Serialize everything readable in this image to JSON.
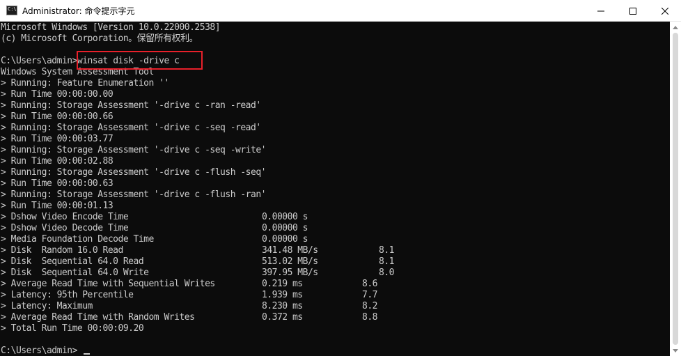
{
  "window": {
    "title": "Administrator: 命令提示字元",
    "icon_name": "cmd-icon",
    "icon_text": "C:\\",
    "controls": [
      "minimize-icon",
      "maximize-icon",
      "close-icon"
    ]
  },
  "console": {
    "header": [
      "Microsoft Windows [Version 10.0.22000.2538]",
      "(c) Microsoft Corporation。保留所有权利。"
    ],
    "prompt": "C:\\Users\\admin>",
    "command": "winsat disk -drive c",
    "tool_name": "Windows System Assessment Tool",
    "run_log": [
      "> Running: Feature Enumeration ''",
      "> Run Time 00:00:00.00",
      "> Running: Storage Assessment '-drive c -ran -read'",
      "> Run Time 00:00:00.66",
      "> Running: Storage Assessment '-drive c -seq -read'",
      "> Run Time 00:00:03.77",
      "> Running: Storage Assessment '-drive c -seq -write'",
      "> Run Time 00:00:02.88",
      "> Running: Storage Assessment '-drive c -flush -seq'",
      "> Run Time 00:00:00.63",
      "> Running: Storage Assessment '-drive c -flush -ran'",
      "> Run Time 00:00:01.13"
    ],
    "results": [
      {
        "label": "> Dshow Video Encode Time",
        "value": "0.00000 s",
        "score": ""
      },
      {
        "label": "> Dshow Video Decode Time",
        "value": "0.00000 s",
        "score": ""
      },
      {
        "label": "> Media Foundation Decode Time",
        "value": "0.00000 s",
        "score": ""
      },
      {
        "label": "> Disk  Random 16.0 Read",
        "value": "341.48 MB/s",
        "score": "8.1",
        "score_col": "wide"
      },
      {
        "label": "> Disk  Sequential 64.0 Read",
        "value": "513.02 MB/s",
        "score": "8.1",
        "score_col": "wide"
      },
      {
        "label": "> Disk  Sequential 64.0 Write",
        "value": "397.95 MB/s",
        "score": "8.0",
        "score_col": "wide"
      },
      {
        "label": "> Average Read Time with Sequential Writes",
        "value": "0.219 ms",
        "score": "8.6",
        "score_col": "narrow"
      },
      {
        "label": "> Latency: 95th Percentile",
        "value": "1.939 ms",
        "score": "7.7",
        "score_col": "narrow"
      },
      {
        "label": "> Latency: Maximum",
        "value": "8.230 ms",
        "score": "8.2",
        "score_col": "narrow"
      },
      {
        "label": "> Average Read Time with Random Writes",
        "value": "0.372 ms",
        "score": "8.8",
        "score_col": "narrow"
      }
    ],
    "total": "> Total Run Time 00:00:09.20",
    "final_prompt": "C:\\Users\\admin>"
  }
}
